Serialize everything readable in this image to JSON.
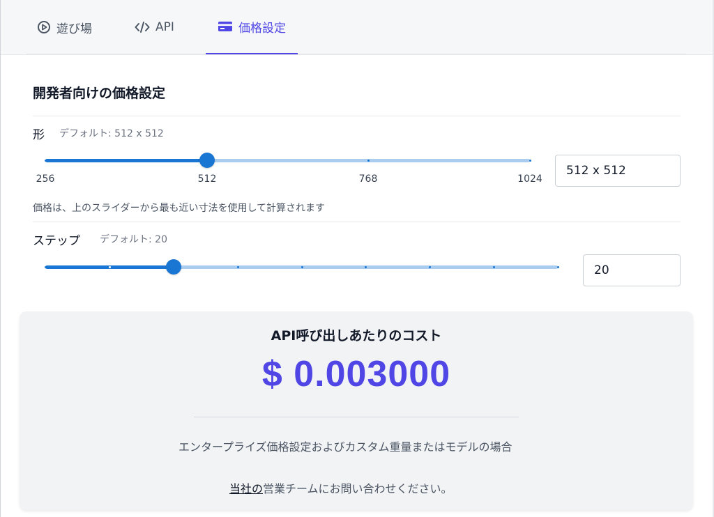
{
  "tabs": [
    {
      "label": "遊び場",
      "icon": "play-circle-icon",
      "active": false
    },
    {
      "label": "API",
      "icon": "code-icon",
      "active": false
    },
    {
      "label": "価格設定",
      "icon": "credit-card-icon",
      "active": true
    }
  ],
  "section": {
    "title": "開発者向けの価格設定"
  },
  "shape": {
    "label": "形",
    "default": "デフォルト: 512 x 512",
    "value": 512,
    "min": 256,
    "max": 1024,
    "marks": [
      "256",
      "512",
      "768",
      "1024"
    ],
    "input_value": "512 x 512",
    "note": "価格は、上のスライダーから最も近い寸法を使用して計算されます"
  },
  "steps": {
    "label": "ステップ",
    "default": "デフォルト: 20",
    "value": 20,
    "min": 0,
    "max": 80,
    "input_value": "20"
  },
  "cost": {
    "title": "API呼び出しあたりのコスト",
    "price": "$ 0.003000",
    "text_line": "エンタープライズ価格設定およびカスタム重量またはモデルの場合",
    "link_text": "当社の",
    "after_link": "営業チームにお問い合わせください。"
  },
  "colors": {
    "accent": "#4f46e5",
    "slider": "#1976d2",
    "slider_track": "#a9ccef"
  }
}
